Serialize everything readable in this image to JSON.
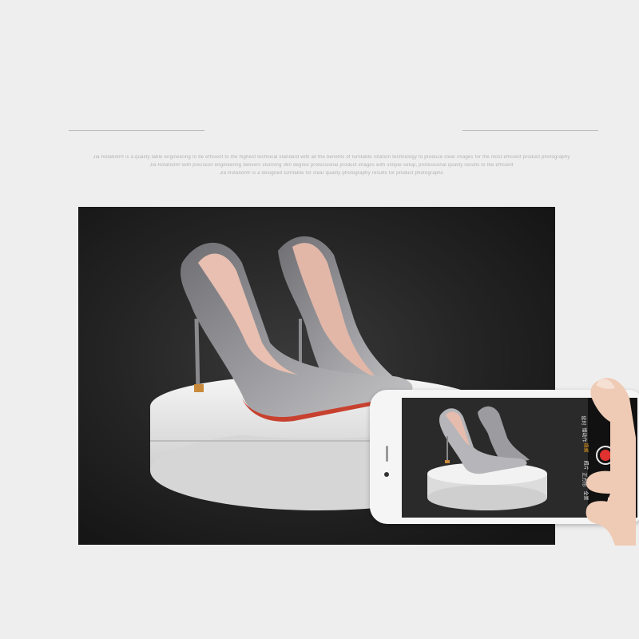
{
  "header": {
    "caption_lines": [
      "Jia Rotation® is a quality table engineering to be efficient to the highest technical standard with all the benefits of turntable rotation technology to produce clear images for the most efficient product photography",
      "Jia Rotation® with precision engineering delivers stunning 360 degree professional product images with simple setup, professional quality results to the efficient",
      "Jia Rotation® is a designed turntable for clear quality photography results for product photographs"
    ]
  },
  "phone": {
    "camera_modes": [
      "延时",
      "慢动作",
      "视频",
      "照片",
      "正方形",
      "全景"
    ],
    "active_mode": "视频"
  },
  "colors": {
    "record": "#e0322f",
    "active_mode": "#f2a418",
    "backdrop": "#242424",
    "page_bg": "#eeeeee"
  }
}
